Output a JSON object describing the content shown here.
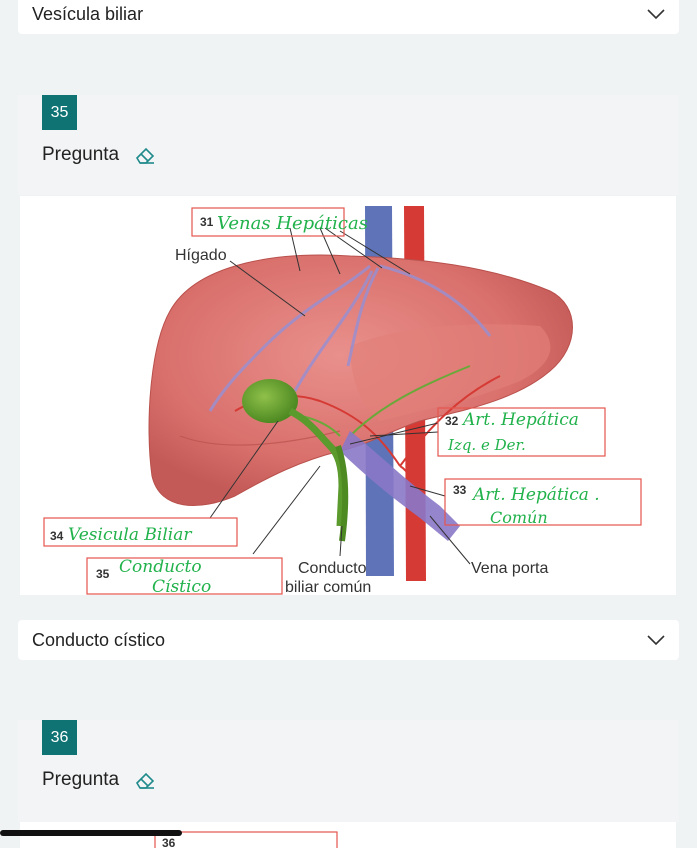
{
  "answers": {
    "a34": "Vesícula biliar",
    "a35": "Conducto cístico"
  },
  "q35": {
    "number": "35",
    "label": "Pregunta"
  },
  "q36": {
    "number": "36",
    "label": "Pregunta"
  },
  "figure": {
    "printed": {
      "n31": "31",
      "n32": "32",
      "n33": "33",
      "n34": "34",
      "n35": "35",
      "n36": "36",
      "higado": "Hígado",
      "conducto_line1": "Conducto",
      "conducto_line2": "biliar común",
      "vena_porta": "Vena porta"
    },
    "handwritten": {
      "h31": "Venas Hepáticas",
      "h32_line1": "Art. Hepática",
      "h32_line2": "Izq. e Der.",
      "h33_line1": "Art. Hepática .",
      "h33_line2": "Común",
      "h34": "Vesicula Biliar",
      "h35_line1": "Conducto",
      "h35_line2": "Cístico"
    }
  },
  "colors": {
    "accent": "#0f7374",
    "handwriting": "#22b24c",
    "label_box": "#e6554e"
  }
}
